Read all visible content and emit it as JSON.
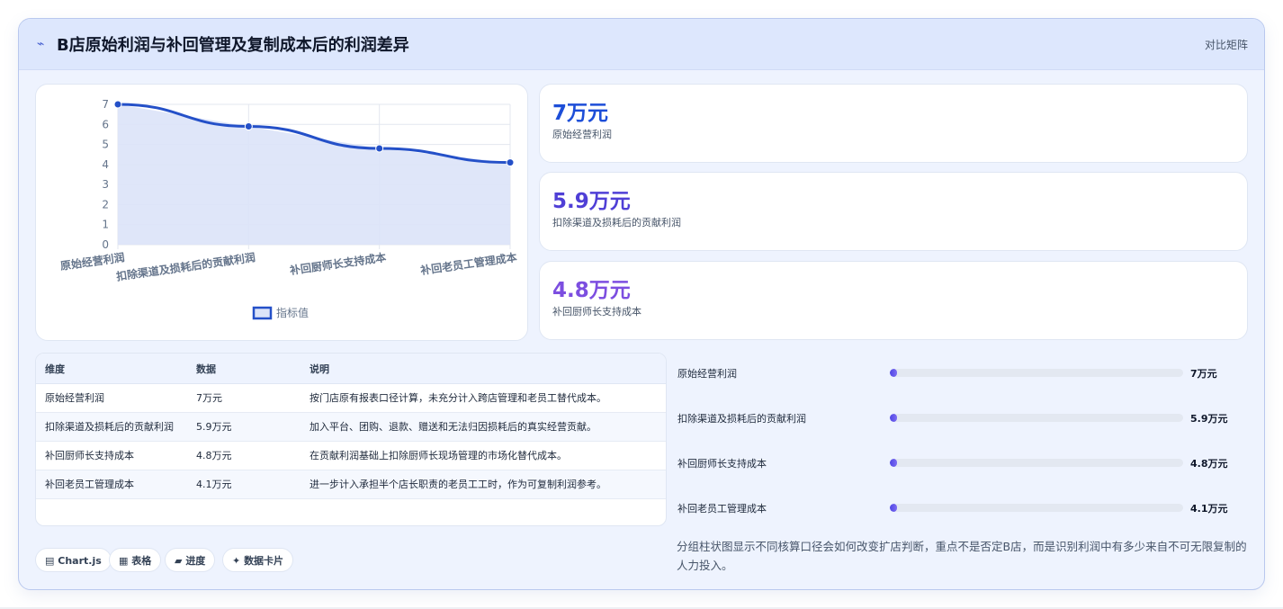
{
  "header": {
    "icon": "pulse-icon",
    "icon_glyph": "⌁",
    "title": "B店原始利润与补回管理及复制成本后的利润差异",
    "action": "对比矩阵"
  },
  "chart_data": {
    "type": "line",
    "categories": [
      "原始经营利润",
      "扣除渠道及损耗后的贡献利润",
      "补回厨师长支持成本",
      "补回老员工管理成本"
    ],
    "series": [
      {
        "name": "指标值",
        "values": [
          7,
          5.9,
          4.8,
          4.1
        ]
      }
    ],
    "yticks": [
      "0",
      "1",
      "2",
      "3",
      "4",
      "5",
      "6",
      "7"
    ],
    "ylim": [
      0,
      7
    ],
    "grid": true,
    "fill": true,
    "legend_position": "bottom",
    "colors": {
      "line": "#2450c8",
      "fill": "#dbe3f8"
    }
  },
  "stats": [
    {
      "value": "7万元",
      "label": "原始经营利润",
      "color": "#1d4ed8"
    },
    {
      "value": "5.9万元",
      "label": "扣除渠道及损耗后的贡献利润",
      "color": "#4f3fd6"
    },
    {
      "value": "4.8万元",
      "label": "补回厨师长支持成本",
      "color": "#7c4ee0"
    }
  ],
  "table": {
    "headers": [
      "维度",
      "数据",
      "说明"
    ],
    "rows": [
      [
        "原始经营利润",
        "7万元",
        "按门店原有报表口径计算，未充分计入跨店管理和老员工替代成本。"
      ],
      [
        "扣除渠道及损耗后的贡献利润",
        "5.9万元",
        "加入平台、团购、退款、赠送和无法归因损耗后的真实经营贡献。"
      ],
      [
        "补回厨师长支持成本",
        "4.8万元",
        "在贡献利润基础上扣除厨师长现场管理的市场化替代成本。"
      ],
      [
        "补回老员工管理成本",
        "4.1万元",
        "进一步计入承担半个店长职责的老员工工时，作为可复制利润参考。"
      ]
    ]
  },
  "progress": [
    {
      "label": "原始经营利润",
      "value": "7万元",
      "fraction": 0.02
    },
    {
      "label": "扣除渠道及损耗后的贡献利润",
      "value": "5.9万元",
      "fraction": 0.02
    },
    {
      "label": "补回厨师长支持成本",
      "value": "4.8万元",
      "fraction": 0.02
    },
    {
      "label": "补回老员工管理成本",
      "value": "4.1万元",
      "fraction": 0.02
    }
  ],
  "note": "分组柱状图显示不同核算口径会如何改变扩店判断，重点不是否定B店，而是识别利润中有多少来自不可无限复制的人力投入。",
  "chips": [
    {
      "icon": "chart-icon",
      "glyph": "▤",
      "label": "Chart.js"
    },
    {
      "icon": "table-icon",
      "glyph": "▦",
      "label": "表格"
    },
    {
      "icon": "progress-icon",
      "glyph": "▰",
      "label": "进度"
    },
    {
      "icon": "card-icon",
      "glyph": "✦",
      "label": "数据卡片"
    }
  ]
}
